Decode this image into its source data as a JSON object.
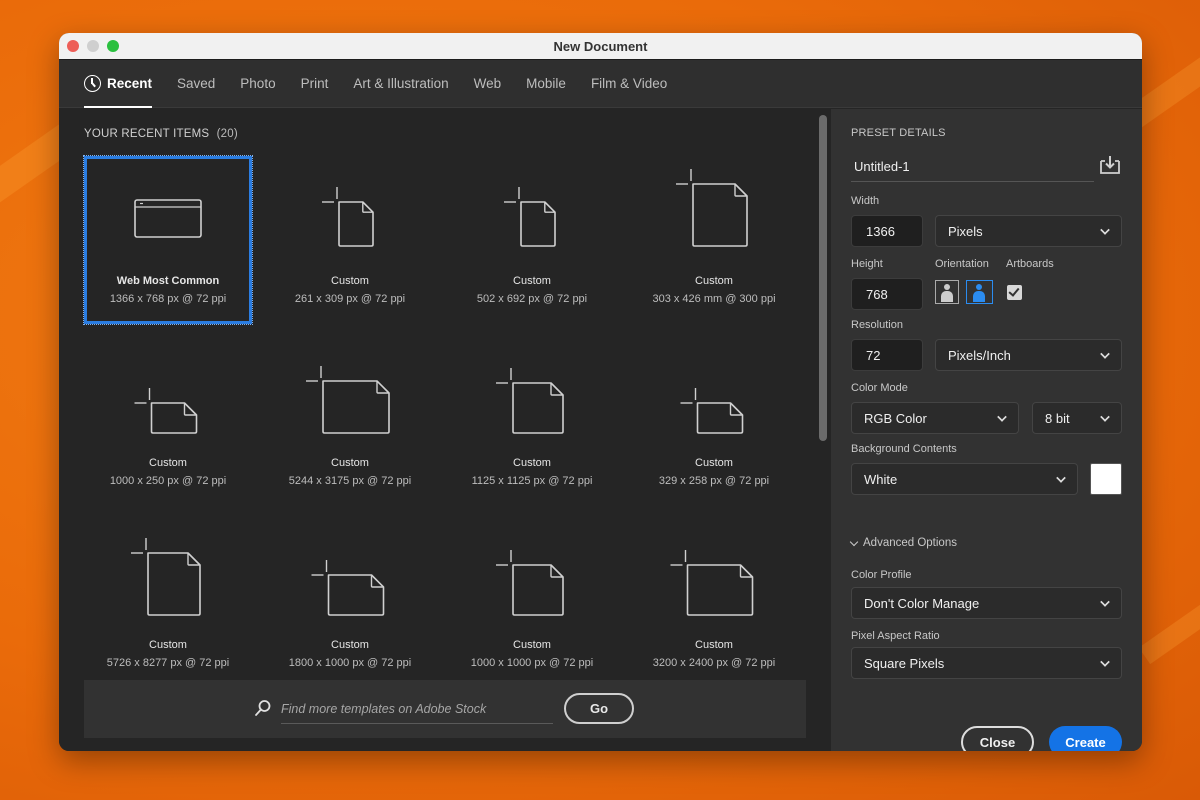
{
  "window": {
    "title": "New Document",
    "traffic_lights": [
      "close",
      "minimize",
      "maximize"
    ]
  },
  "tabs": [
    {
      "label": "Recent",
      "active": true,
      "icon": "clock-icon"
    },
    {
      "label": "Saved",
      "active": false
    },
    {
      "label": "Photo",
      "active": false
    },
    {
      "label": "Print",
      "active": false
    },
    {
      "label": "Art & Illustration",
      "active": false
    },
    {
      "label": "Web",
      "active": false
    },
    {
      "label": "Mobile",
      "active": false
    },
    {
      "label": "Film & Video",
      "active": false
    }
  ],
  "recent": {
    "title": "YOUR RECENT ITEMS",
    "count": "(20)",
    "items": [
      {
        "name": "Web Most Common",
        "size": "1366 x 768 px @ 72 ppi",
        "icon": "web-document-icon",
        "selected": true
      },
      {
        "name": "Custom",
        "size": "261 x 309 px @ 72 ppi",
        "icon": "portrait-document-icon"
      },
      {
        "name": "Custom",
        "size": "502 x 692 px @ 72 ppi",
        "icon": "portrait-document-icon"
      },
      {
        "name": "Custom",
        "size": "303 x 426 mm @ 300 ppi",
        "icon": "portrait-document-icon"
      },
      {
        "name": "Custom",
        "size": "1000 x 250 px @ 72 ppi",
        "icon": "landscape-document-icon"
      },
      {
        "name": "Custom",
        "size": "5244 x 3175 px @ 72 ppi",
        "icon": "landscape-document-icon"
      },
      {
        "name": "Custom",
        "size": "1125 x 1125 px @ 72 ppi",
        "icon": "square-document-icon"
      },
      {
        "name": "Custom",
        "size": "329 x 258 px @ 72 ppi",
        "icon": "landscape-document-icon"
      },
      {
        "name": "Custom",
        "size": "5726 x 8277 px @ 72 ppi",
        "icon": "portrait-document-icon"
      },
      {
        "name": "Custom",
        "size": "1800 x 1000 px @ 72 ppi",
        "icon": "landscape-document-icon"
      },
      {
        "name": "Custom",
        "size": "1000 x 1000 px @ 72 ppi",
        "icon": "square-document-icon"
      },
      {
        "name": "Custom",
        "size": "3200 x 2400 px @ 72 ppi",
        "icon": "landscape-document-icon"
      }
    ]
  },
  "search": {
    "placeholder": "Find more templates on Adobe Stock",
    "value": "",
    "go_label": "Go"
  },
  "preset": {
    "heading": "PRESET DETAILS",
    "name": "Untitled-1",
    "width_label": "Width",
    "width_value": "1366",
    "width_unit": "Pixels",
    "height_label": "Height",
    "height_value": "768",
    "orientation_label": "Orientation",
    "orientation": "landscape",
    "artboards_label": "Artboards",
    "artboards_checked": true,
    "resolution_label": "Resolution",
    "resolution_value": "72",
    "resolution_unit": "Pixels/Inch",
    "color_mode_label": "Color Mode",
    "color_mode": "RGB Color",
    "bit_depth": "8 bit",
    "background_label": "Background Contents",
    "background": "White",
    "background_color": "#ffffff",
    "advanced_label": "Advanced Options",
    "color_profile_label": "Color Profile",
    "color_profile": "Don't Color Manage",
    "pixel_aspect_label": "Pixel Aspect Ratio",
    "pixel_aspect": "Square Pixels"
  },
  "actions": {
    "close_label": "Close",
    "create_label": "Create"
  },
  "colors": {
    "accent": "#1473e6",
    "selection": "#2b7de1"
  }
}
